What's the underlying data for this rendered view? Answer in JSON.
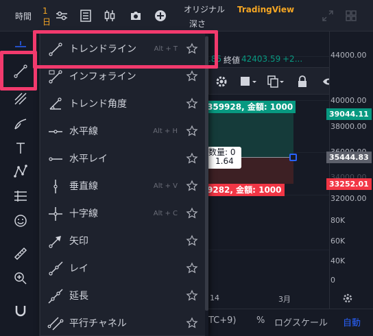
{
  "topbar": {
    "time_label": "時間",
    "interval_value": "1",
    "interval_unit": "日",
    "original_label_line1": "オリジナル",
    "original_label_line2": "深さ",
    "tradingview_label": "TradingView",
    "accent_color": "#f5a623"
  },
  "chart": {
    "ohlc_partial": ".85",
    "close_label": "終値",
    "close_value": "42403.59",
    "change_value": "+2...",
    "long_position_label": "359928, 金額: 1000",
    "short_position_label": "9282, 金額: 1000",
    "center_label_line1": "数量: 0",
    "center_label_line2": "1.64",
    "x_axis_labels": [
      "14",
      "3月"
    ],
    "timezone_label": "TC+9)",
    "percent_label": "%",
    "log_scale_label": "ログスケール",
    "auto_label": "自動"
  },
  "price_axis": {
    "labels": [
      "44000.00",
      "40000.00",
      "38000.00",
      "36000.00",
      "34000.00",
      "32000.00",
      "80K",
      "60K",
      "40K",
      "20K",
      "0"
    ],
    "tag_green": "39044.11",
    "tag_gray": "35444.83",
    "tag_red": "33252.01",
    "green": "#089981",
    "red": "#f23645",
    "gray": "#5d606b"
  },
  "menu": {
    "items": [
      {
        "label": "トレンドライン",
        "shortcut": "Alt + T",
        "icon": "trend-line-icon"
      },
      {
        "label": "インフォライン",
        "shortcut": "",
        "icon": "info-line-icon"
      },
      {
        "label": "トレンド角度",
        "shortcut": "",
        "icon": "trend-angle-icon"
      },
      {
        "label": "水平線",
        "shortcut": "Alt + H",
        "icon": "horizontal-line-icon"
      },
      {
        "label": "水平レイ",
        "shortcut": "",
        "icon": "horizontal-ray-icon"
      },
      {
        "label": "垂直線",
        "shortcut": "Alt + V",
        "icon": "vertical-line-icon"
      },
      {
        "label": "十字線",
        "shortcut": "Alt + C",
        "icon": "cross-line-icon"
      },
      {
        "label": "矢印",
        "shortcut": "",
        "icon": "arrow-icon"
      },
      {
        "label": "レイ",
        "shortcut": "",
        "icon": "ray-icon"
      },
      {
        "label": "延長",
        "shortcut": "",
        "icon": "extended-line-icon"
      },
      {
        "label": "平行チャネル",
        "shortcut": "",
        "icon": "parallel-channel-icon"
      }
    ]
  },
  "highlight_color": "#f23a6d"
}
